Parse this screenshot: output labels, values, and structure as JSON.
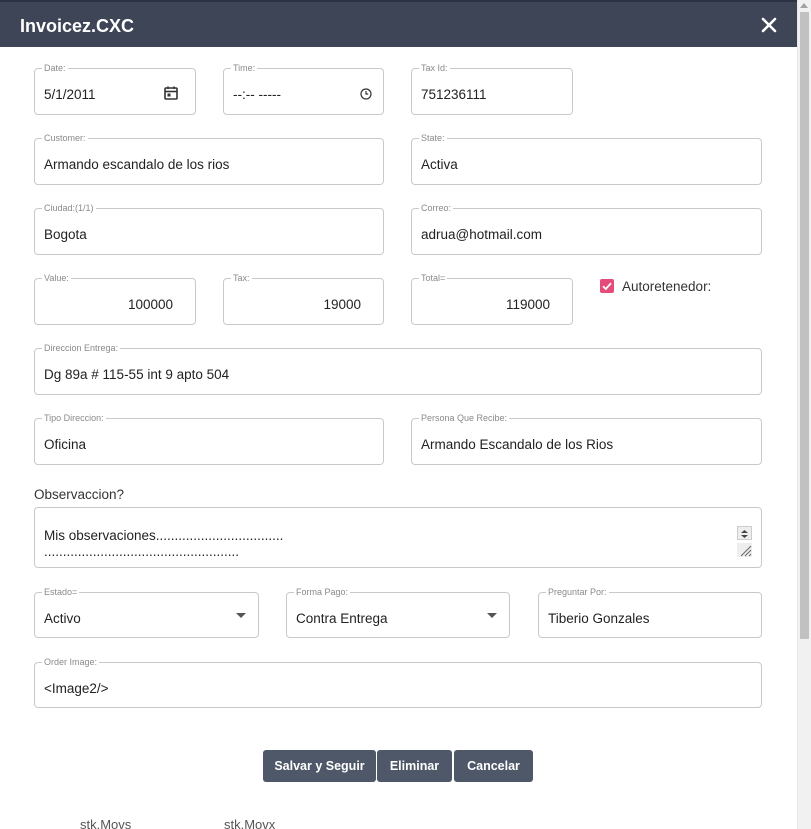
{
  "header": {
    "title": "Invoicez.CXC"
  },
  "fields": {
    "date": {
      "label": "Date:",
      "value": "5/1/2011"
    },
    "time": {
      "label": "Time:",
      "value": "--:-- -----"
    },
    "tax_id": {
      "label": "Tax Id:",
      "value": "751236111"
    },
    "customer": {
      "label": "Customer:",
      "value": "Armando escandalo de los rios"
    },
    "state": {
      "label": "State:",
      "value": "Activa"
    },
    "ciudad": {
      "label": "Ciudad:(1/1)",
      "value": "Bogota"
    },
    "correo": {
      "label": "Correo:",
      "value": "adrua@hotmail.com"
    },
    "value": {
      "label": "Value:",
      "value": "100000"
    },
    "tax": {
      "label": "Tax:",
      "value": "19000"
    },
    "total": {
      "label": "Total=",
      "value": "119000"
    },
    "autoretenedor": {
      "label": "Autoretenedor:",
      "checked": true
    },
    "direccion": {
      "label": "Direccion Entrega:",
      "value": "Dg 89a # 115-55 int 9 apto 504"
    },
    "tipo_direccion": {
      "label": "Tipo Direccion:",
      "value": "Oficina"
    },
    "persona": {
      "label": "Persona Que Recibe:",
      "value": "Armando Escandalo de los Rios"
    },
    "observaccion": {
      "label": "Observaccion?",
      "line1": "Mis observaciones..................................",
      "line2": "...................................................."
    },
    "estado": {
      "label": "Estado=",
      "value": "Activo"
    },
    "forma_pago": {
      "label": "Forma Pago:",
      "value": "Contra Entrega"
    },
    "preguntar": {
      "label": "Preguntar Por:",
      "value": "Tiberio Gonzales"
    },
    "order_image": {
      "label": "Order Image:",
      "value": "<Image2/>"
    }
  },
  "buttons": {
    "save": "Salvar y Seguir",
    "delete": "Eliminar",
    "cancel": "Cancelar"
  },
  "tabs": [
    "stk.Movs",
    "stk.Movx"
  ],
  "colors": {
    "header": "#3d4556",
    "button": "#4f5868",
    "checkbox": "#e44d7a"
  }
}
